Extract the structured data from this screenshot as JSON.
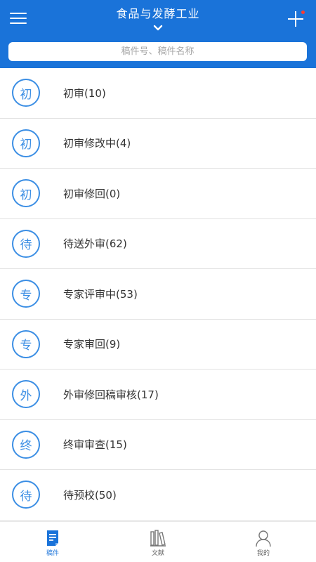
{
  "header": {
    "title": "食品与发酵工业",
    "search_placeholder": "稿件号、稿件名称"
  },
  "list": {
    "items": [
      {
        "badge": "初",
        "label": "初审(10)"
      },
      {
        "badge": "初",
        "label": "初审修改中(4)"
      },
      {
        "badge": "初",
        "label": "初审修回(0)"
      },
      {
        "badge": "待",
        "label": "待送外审(62)"
      },
      {
        "badge": "专",
        "label": "专家评审中(53)"
      },
      {
        "badge": "专",
        "label": "专家审回(9)"
      },
      {
        "badge": "外",
        "label": "外审修回稿审核(17)"
      },
      {
        "badge": "终",
        "label": "终审审查(15)"
      },
      {
        "badge": "待",
        "label": "待预校(50)"
      }
    ]
  },
  "tabbar": {
    "tabs": [
      {
        "label": "稿件",
        "icon": "document-icon",
        "active": true
      },
      {
        "label": "文献",
        "icon": "books-icon",
        "active": false
      },
      {
        "label": "我的",
        "icon": "user-icon",
        "active": false
      }
    ]
  },
  "colors": {
    "primary": "#1a73d9",
    "badge": "#3b8ee4",
    "notification_dot": "#ff3b30"
  }
}
